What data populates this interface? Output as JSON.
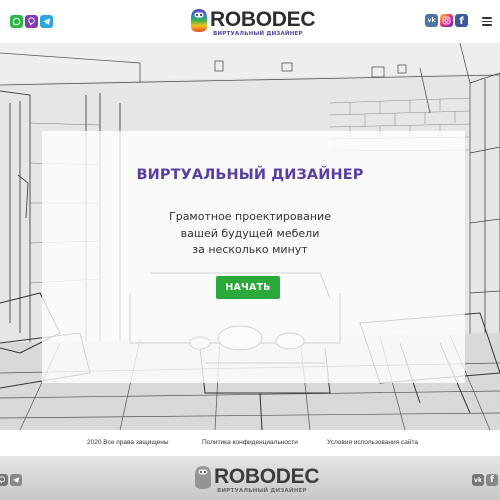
{
  "header": {
    "brand": "ROBODEC",
    "tagline": "ВИРТУАЛЬНЫЙ ДИЗАЙНЕР",
    "messengers": [
      "whatsapp-icon",
      "viber-icon",
      "telegram-icon"
    ],
    "socials": [
      {
        "icon": "vk-icon",
        "label": "vk"
      },
      {
        "icon": "instagram-icon",
        "label": ""
      },
      {
        "icon": "facebook-icon",
        "label": "f"
      }
    ],
    "menu_icon": "hamburger-menu-icon"
  },
  "hero": {
    "title": "ВИРТУАЛЬНЫЙ ДИЗАЙНЕР",
    "lines": [
      "Грамотное проектирование",
      "вашей будущей мебели",
      "за несколько минут"
    ],
    "cta_label": "НАЧАТЬ"
  },
  "footer": {
    "copyright": "2020 Все права защищены",
    "privacy": "Политика конфиденциальности",
    "terms": "Условия использования сайта"
  },
  "bottom_bar": {
    "brand": "ROBODEC",
    "tagline": "ВИРТУАЛЬНЫЙ ДИЗАЙНЕР",
    "vk_label": "vk",
    "fb_label": "f"
  },
  "colors": {
    "accent_purple": "#5b3ea4",
    "cta_green": "#2aa83a",
    "whatsapp": "#2bb741",
    "viber": "#7d3daf",
    "telegram": "#2ca5e0",
    "vk": "#4a76a8",
    "facebook": "#3b5998"
  }
}
